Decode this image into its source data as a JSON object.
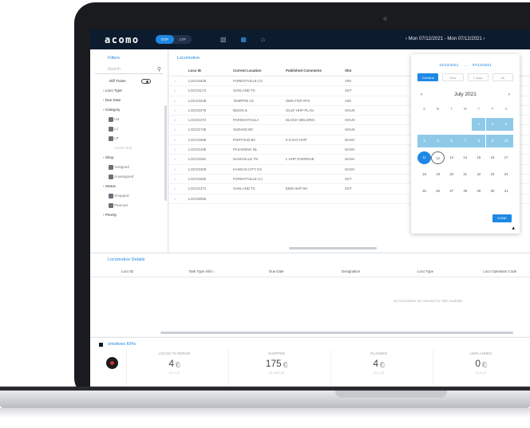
{
  "app": {
    "brand": "acomo",
    "toggle": [
      "GTP",
      "LTP"
    ],
    "date_range": "‹  Mon 07/12/2021 - Mon 07/12/2021  ›"
  },
  "filters": {
    "title": "Filters",
    "search_placeholder": "Search",
    "diff_trains": "Diff Trains",
    "items": [
      {
        "label": "Loco Type",
        "kind": "head"
      },
      {
        "label": "Due Date",
        "kind": "head"
      },
      {
        "label": "Category",
        "kind": "head"
      },
      {
        "label": "LM",
        "kind": "check"
      },
      {
        "label": "LC",
        "kind": "check"
      },
      {
        "label": "LP",
        "kind": "check"
      },
      {
        "label": "Active Hub",
        "kind": "sub"
      },
      {
        "label": "Shop",
        "kind": "head"
      },
      {
        "label": "Assigned",
        "kind": "check"
      },
      {
        "label": "Unassigned",
        "kind": "check"
      },
      {
        "label": "Status",
        "kind": "head"
      },
      {
        "label": "Shopped",
        "kind": "check"
      },
      {
        "label": "Planned",
        "kind": "check"
      },
      {
        "label": "Priority",
        "kind": "head"
      }
    ]
  },
  "locomotive": {
    "title": "Locomotive",
    "columns": [
      "Loco ID",
      "Current Location",
      "Published Comments",
      "Sho"
    ],
    "rows": [
      [
        "LOCO1828",
        "FORESTVILLE CA",
        "",
        "A00"
      ],
      [
        "LOCO1173",
        "OAKLAND TX",
        "",
        "SST"
      ],
      [
        "LOCO2238",
        "TEMPPIE AZ",
        "OMS FOR RTS",
        "A05"
      ],
      [
        "LOCO1076",
        "BISON IL",
        "GULF HHP PLAN",
        "HOUS"
      ],
      [
        "LOCO1372",
        "PARDHATOULA",
        "BLOCK WELDING",
        "HOUS"
      ],
      [
        "LOCO1745",
        "SUDAKE BC",
        "",
        "HOUS"
      ],
      [
        "LOCO1565",
        "PORTSAD BC",
        "0 5 DAY HHP",
        "NASH"
      ],
      [
        "LOCO1435",
        "PASADENA NL",
        "",
        "NASH"
      ],
      [
        "LOCO1081",
        "NASHVILLE TN",
        "L HHP OVERDUE",
        "NASH"
      ],
      [
        "LOCO2409",
        "KANSAS CITY KS",
        "",
        "NASH"
      ],
      [
        "LOCO1582",
        "FORESTVILLE CA",
        "",
        "SST"
      ],
      [
        "LOCO1371",
        "OAKLAND TX",
        "EMD HHP 9H",
        "SST"
      ],
      [
        "LOCO8055",
        "",
        "",
        ""
      ]
    ]
  },
  "calendar": {
    "range_from": "10/12/2021",
    "range_to": "07/12/2021",
    "tabs": [
      "Overdue",
      "Now",
      "1 days",
      "All"
    ],
    "month": "July 2021",
    "weekdays": [
      "S",
      "M",
      "T",
      "W",
      "T",
      "F",
      "S"
    ],
    "days": [
      "",
      "",
      "",
      "",
      "1",
      "2",
      "3",
      "4",
      "5",
      "6",
      "7",
      "8",
      "9",
      "10",
      "11",
      "12",
      "13",
      "14",
      "15",
      "16",
      "17",
      "18",
      "19",
      "20",
      "21",
      "22",
      "23",
      "24",
      "25",
      "26",
      "27",
      "28",
      "29",
      "30",
      "31"
    ],
    "done_label": "DONE"
  },
  "details": {
    "title": "Locomotive Details",
    "columns": [
      "Loco ID",
      "Task Type Abbr ↓",
      "Due Date",
      "Designation",
      "Loco Type",
      "Loco Operation Code"
    ],
    "empty_text": "No locomotives are selected for Tabs available"
  },
  "kpis": {
    "title": "omotives KPIs",
    "cards": [
      {
        "label": "LOCOS TO REPAIR",
        "value": "4",
        "sub": "0 | 0 | 3"
      },
      {
        "label": "SHOPPED",
        "value": "175",
        "sub": "42 | 88 | 33"
      },
      {
        "label": "PLANNED",
        "value": "4",
        "sub": "0 | 1 | 3"
      },
      {
        "label": "UNPLANNED",
        "value": "0",
        "sub": "0 | 0 | 0"
      }
    ]
  }
}
